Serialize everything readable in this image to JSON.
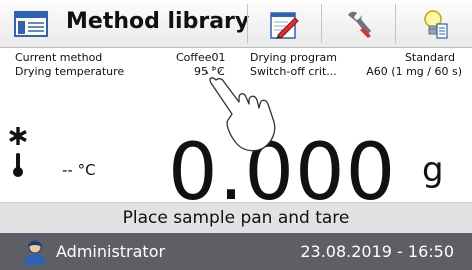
{
  "header": {
    "title": "Method library",
    "icons": [
      "method-library-icon",
      "edit-icon",
      "settings-wrench-icon",
      "help-bulb-icon"
    ]
  },
  "info": {
    "current_method_label": "Current method",
    "current_method_value": "Coffee01",
    "drying_program_label": "Drying program",
    "drying_program_value": "Standard",
    "drying_temperature_label": "Drying temperature",
    "drying_temperature_value": "95 °C",
    "switch_off_label": "Switch-off crit...",
    "switch_off_value": "A60  (1 mg / 60 s)"
  },
  "display": {
    "temperature": "-- °C",
    "weight": "0.000",
    "unit": "g"
  },
  "status_message": "Place sample pan and tare",
  "footer": {
    "user": "Administrator",
    "datetime": "23.08.2019 - 16:50"
  },
  "colors": {
    "toolbar_bg": "#eeeeee",
    "status_bg": "#e2e2e2",
    "footer_bg": "#5d5f64"
  }
}
